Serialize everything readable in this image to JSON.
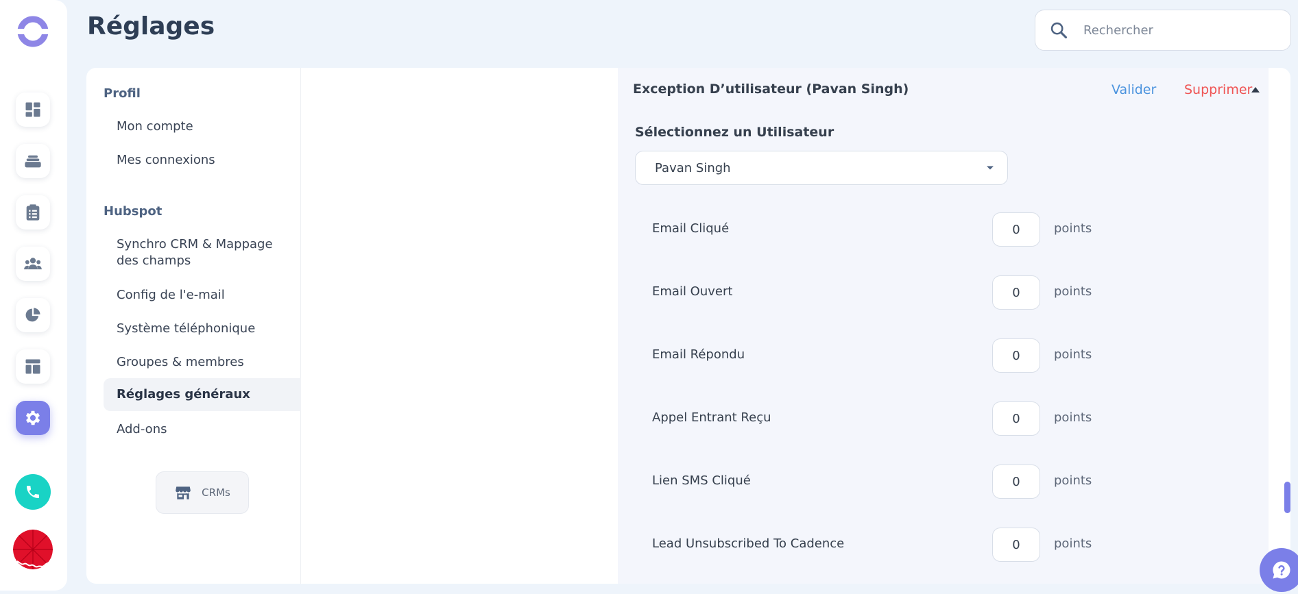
{
  "page": {
    "title": "Réglages"
  },
  "search": {
    "placeholder": "Rechercher",
    "value": ""
  },
  "rail": {
    "items": [
      {
        "icon": "dashboard-icon"
      },
      {
        "icon": "stack-icon"
      },
      {
        "icon": "clipboard-icon"
      },
      {
        "icon": "people-icon"
      },
      {
        "icon": "pie-chart-icon"
      },
      {
        "icon": "layout-icon"
      },
      {
        "icon": "gear-icon",
        "active": true
      }
    ],
    "accent": "#7b7fe8",
    "phone_color": "#19d3c5"
  },
  "nav": {
    "sections": [
      {
        "title": "Profil",
        "items": [
          {
            "label": "Mon compte"
          },
          {
            "label": "Mes connexions"
          }
        ]
      },
      {
        "title": "Hubspot",
        "items": [
          {
            "label": "Synchro CRM & Mappage des champs"
          },
          {
            "label": "Config de l'e-mail"
          },
          {
            "label": "Système téléphonique"
          },
          {
            "label": "Groupes & membres"
          },
          {
            "label": "Réglages généraux",
            "active": true
          },
          {
            "label": "Add-ons"
          }
        ]
      }
    ],
    "crm_button": "CRMs"
  },
  "exception": {
    "title": "Exception D’utilisateur (Pavan Singh)",
    "validate_label": "Valider",
    "delete_label": "Supprimer",
    "select_label": "Sélectionnez un Utilisateur",
    "selected_user": "Pavan Singh",
    "unit": "points",
    "rows": [
      {
        "label": "Email Cliqué",
        "value": "0"
      },
      {
        "label": "Email Ouvert",
        "value": "0"
      },
      {
        "label": "Email Répondu",
        "value": "0"
      },
      {
        "label": "Appel Entrant Reçu",
        "value": "0"
      },
      {
        "label": "Lien SMS Cliqué",
        "value": "0"
      },
      {
        "label": "Lead Unsubscribed To Cadence",
        "value": "0"
      }
    ],
    "colors": {
      "validate": "#4a93de",
      "delete": "#ef5454"
    }
  }
}
